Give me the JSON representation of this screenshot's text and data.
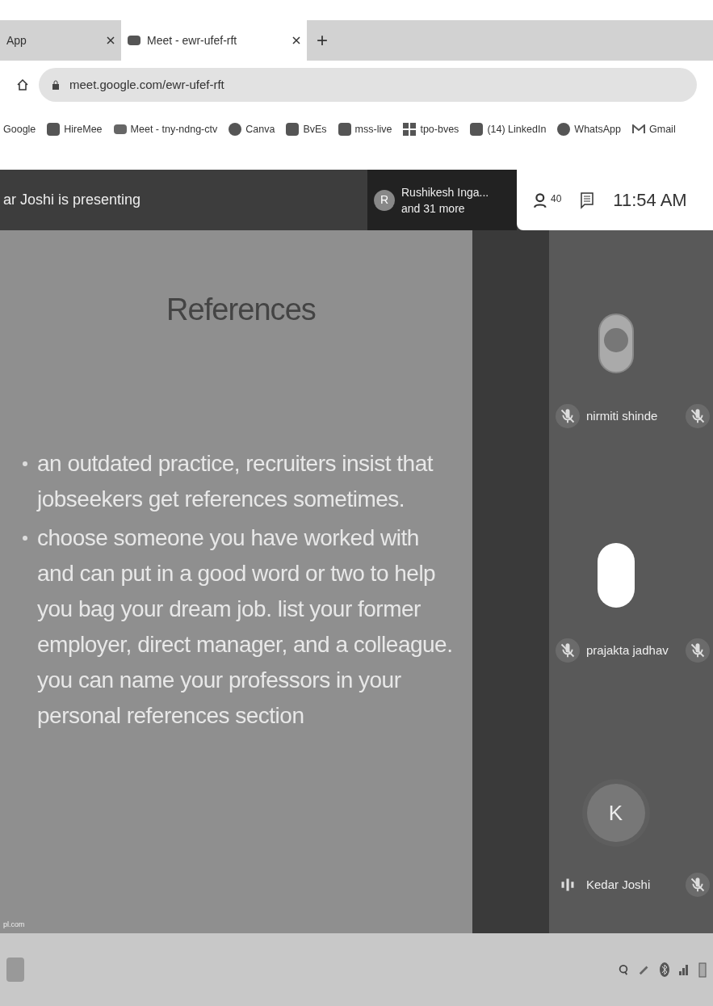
{
  "browser": {
    "tabs": [
      {
        "title": "App",
        "selected": false
      },
      {
        "title": "Meet - ewr-ufef-rft",
        "selected": true
      }
    ],
    "new_tab": "+",
    "url": "meet.google.com/ewr-ufef-rft",
    "bookmarks": [
      {
        "label": "Google",
        "kind": "plain"
      },
      {
        "label": "HireMee",
        "kind": "square"
      },
      {
        "label": "Meet - tny-ndng-ctv",
        "kind": "camera"
      },
      {
        "label": "Canva",
        "kind": "circle"
      },
      {
        "label": "BvEs",
        "kind": "square"
      },
      {
        "label": "mss-live",
        "kind": "square"
      },
      {
        "label": "tpo-bves",
        "kind": "grid"
      },
      {
        "label": "(14) LinkedIn",
        "kind": "square"
      },
      {
        "label": "WhatsApp",
        "kind": "circle"
      },
      {
        "label": "Gmail",
        "kind": "mail"
      }
    ]
  },
  "meet": {
    "presenting": "ar Joshi is presenting",
    "others": {
      "initial": "R",
      "name": "Rushikesh Inga...",
      "more": "and 31 more"
    },
    "people_count": "40",
    "time": "11:54 AM"
  },
  "slide": {
    "title": "References",
    "bullets": [
      "an outdated practice, recruiters insist that jobseekers get references sometimes.",
      "choose someone you have worked with and can put in a good word or two to help you bag your dream job. list your former employer, direct manager, and a colleague. you can name your professors in your personal references section"
    ],
    "footer": "pl.com"
  },
  "participants": [
    {
      "name": "nirmiti shinde",
      "kind": "photo",
      "muted": true
    },
    {
      "name": "prajakta jadhav",
      "kind": "blank",
      "muted": true
    },
    {
      "name": "Kedar Joshi",
      "kind": "initial",
      "initial": "K",
      "muted": false
    }
  ],
  "cut_participants": [
    {
      "muted": true
    },
    {
      "muted": true
    },
    {
      "muted": true
    }
  ]
}
